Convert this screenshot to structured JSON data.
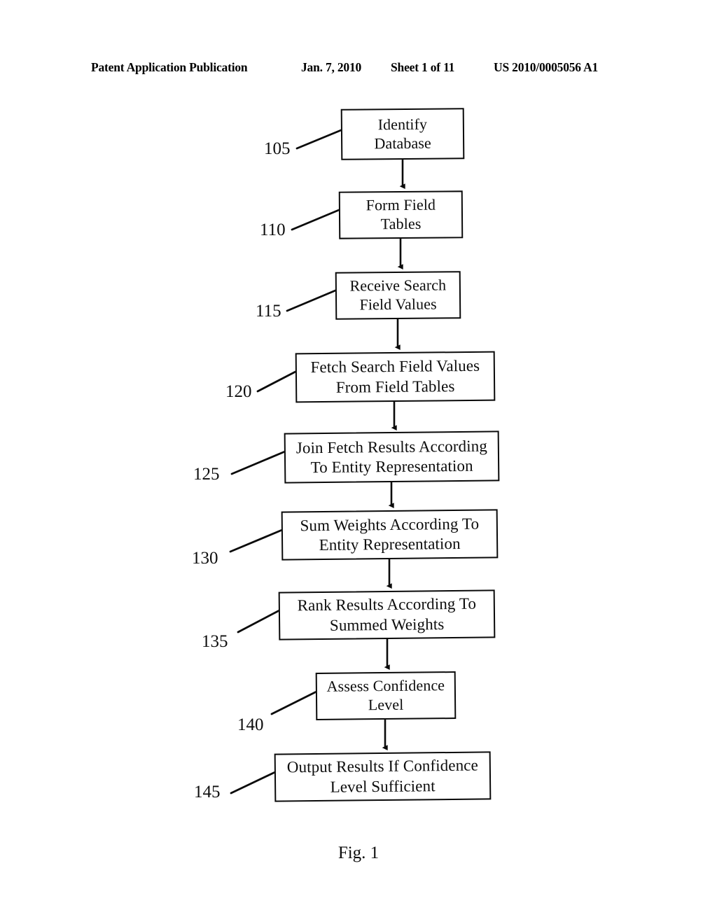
{
  "header": {
    "publication": "Patent Application Publication",
    "date": "Jan. 7, 2010",
    "sheet": "Sheet 1 of 11",
    "patent_number": "US 2010/0005056 A1"
  },
  "figure": {
    "caption": "Fig. 1",
    "type": "flowchart",
    "orientation": "vertical-top-to-bottom"
  },
  "flowchart": {
    "nodes": [
      {
        "ref": "105",
        "line1": "Identify",
        "line2": "Database"
      },
      {
        "ref": "110",
        "line1": "Form Field",
        "line2": "Tables"
      },
      {
        "ref": "115",
        "line1": "Receive Search",
        "line2": "Field Values"
      },
      {
        "ref": "120",
        "line1": "Fetch Search Field Values",
        "line2": "From Field Tables"
      },
      {
        "ref": "125",
        "line1": "Join Fetch Results According",
        "line2": "To Entity Representation"
      },
      {
        "ref": "130",
        "line1": "Sum Weights According To",
        "line2": "Entity Representation"
      },
      {
        "ref": "135",
        "line1": "Rank Results According To",
        "line2": "Summed Weights"
      },
      {
        "ref": "140",
        "line1": "Assess Confidence",
        "line2": "Level"
      },
      {
        "ref": "145",
        "line1": "Output Results If Confidence",
        "line2": "Level Sufficient"
      }
    ]
  }
}
